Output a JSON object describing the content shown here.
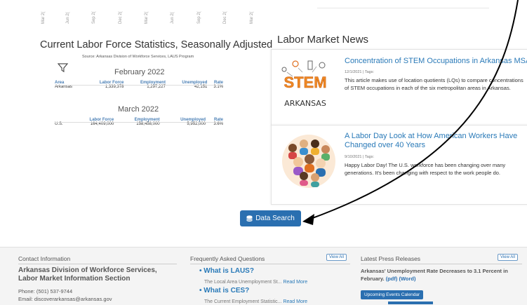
{
  "axis": {
    "ticks": [
      "Mar 2(",
      "Jun 2(",
      "Sep 2(",
      "Dec 2(",
      "Mar 2(",
      "Jun 2(",
      "Sep 2(",
      "Dec 2(",
      "Mar 2("
    ]
  },
  "stats": {
    "title": "Current Labor Force Statistics, Seasonally Adjusted",
    "source": "Source: Arkansas Division of Workforce Services, LAUS Program",
    "state": {
      "period": "February 2022",
      "headers": [
        "Area",
        "Labor Force",
        "Employment",
        "Unemployed",
        "Rate"
      ],
      "row": [
        "Arkansas",
        "1,339,378",
        "1,297,227",
        "42,151",
        "3.1%"
      ]
    },
    "us": {
      "period": "March 2022",
      "headers": [
        "Labor Force",
        "Employment",
        "Unemployed",
        "Rate"
      ],
      "row": [
        "U.S.",
        "164,409,000",
        "158,458,000",
        "5,952,000",
        "3.6%"
      ]
    }
  },
  "news": {
    "title": "Labor Market News",
    "items": [
      {
        "title": "Concentration of STEM Occupations in Arkansas MSAs",
        "meta": "12/1/2021 | Tags:",
        "body": "This article makes use of location quotients (LQs) to compare concentrations of STEM occupations in each of the six metropolitan areas in Arkansas.",
        "image_top": "STEM",
        "image_bottom": "ARKANSAS"
      },
      {
        "title_line1": "A Labor Day Look at How American Workers Have",
        "title_line2": "Changed over 40 Years",
        "meta": "9/10/2021 | Tags:",
        "body": "Happy Labor Day! The U.S. workforce has been changing over many generations. It's been changing with respect to the work people do."
      }
    ]
  },
  "data_search": {
    "label": "Data Search"
  },
  "footer": {
    "contact": {
      "heading": "Contact Information",
      "org_line1": "Arkansas Division of Workforce Services,",
      "org_line2": "Labor Market Information Section",
      "phone": "Phone: (501) 537-9744",
      "email": "Email: discoverarkansas@arkansas.gov"
    },
    "faq": {
      "heading": "Frequently Asked Questions",
      "view_all": "View All",
      "items": [
        {
          "question": "What is LAUS?",
          "desc": "The Local Area Unemployment St...",
          "more": "Read More"
        },
        {
          "question": "What is CES?",
          "desc": "The Current Employment Statistic...",
          "more": "Read More"
        }
      ]
    },
    "press": {
      "heading": "Latest Press Releases",
      "view_all": "View All",
      "headline": "Arkansas' Unemployment Rate Decreases to 3.1 Percent in February.",
      "pdf": "(pdf)",
      "word": "(Word)",
      "events": "Upcoming Events Calendar"
    }
  },
  "colors": {
    "accent": "#2a6fb0",
    "link": "#2a7ab8",
    "header_text": "#4a7fb5"
  }
}
